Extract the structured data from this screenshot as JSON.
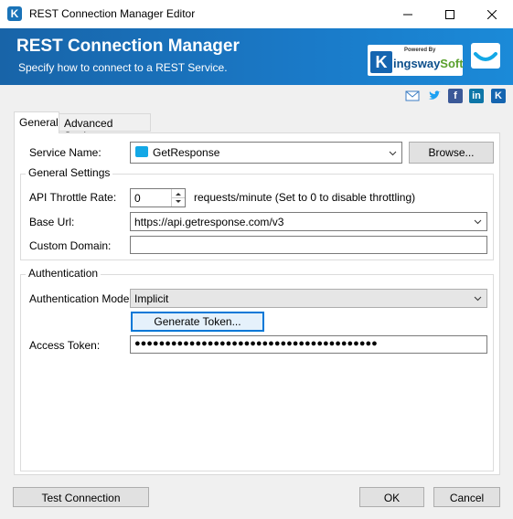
{
  "window": {
    "title": "REST Connection Manager Editor",
    "app_icon_letter": "K"
  },
  "banner": {
    "title": "REST Connection Manager",
    "subtitle": "Specify how to connect to a REST Service.",
    "logo_powered_by": "Powered By",
    "logo_kingsway": "ingsway",
    "logo_soft": "Soft",
    "logo_k": "K"
  },
  "social": {
    "icons": [
      "email-icon",
      "twitter-icon",
      "facebook-icon",
      "linkedin-icon",
      "kingswaysoft-icon"
    ],
    "linkedin_text": "in",
    "facebook_text": "f",
    "k_text": "K"
  },
  "tabs": [
    {
      "label": "General",
      "selected": true
    },
    {
      "label": "Advanced Settings",
      "selected": false
    }
  ],
  "general": {
    "service_name_label": "Service Name:",
    "service_name_value": "GetResponse",
    "browse_label": "Browse...",
    "general_settings_title": "General Settings",
    "throttle_label": "API Throttle Rate:",
    "throttle_value": "0",
    "throttle_hint": "requests/minute (Set to 0 to disable throttling)",
    "base_url_label": "Base Url:",
    "base_url_value": "https://api.getresponse.com/v3",
    "custom_domain_label": "Custom Domain:",
    "custom_domain_value": "",
    "authentication_title": "Authentication",
    "auth_mode_label": "Authentication Mode:",
    "auth_mode_value": "Implicit",
    "generate_token_label": "Generate Token...",
    "access_token_label": "Access Token:",
    "access_token_value": "●●●●●●●●●●●●●●●●●●●●●●●●●●●●●●●●●●●●●●●●"
  },
  "footer": {
    "test_connection_label": "Test Connection",
    "ok_label": "OK",
    "cancel_label": "Cancel"
  },
  "colors": {
    "banner": "#1a7ac8",
    "accent_focus": "#0078d7"
  }
}
